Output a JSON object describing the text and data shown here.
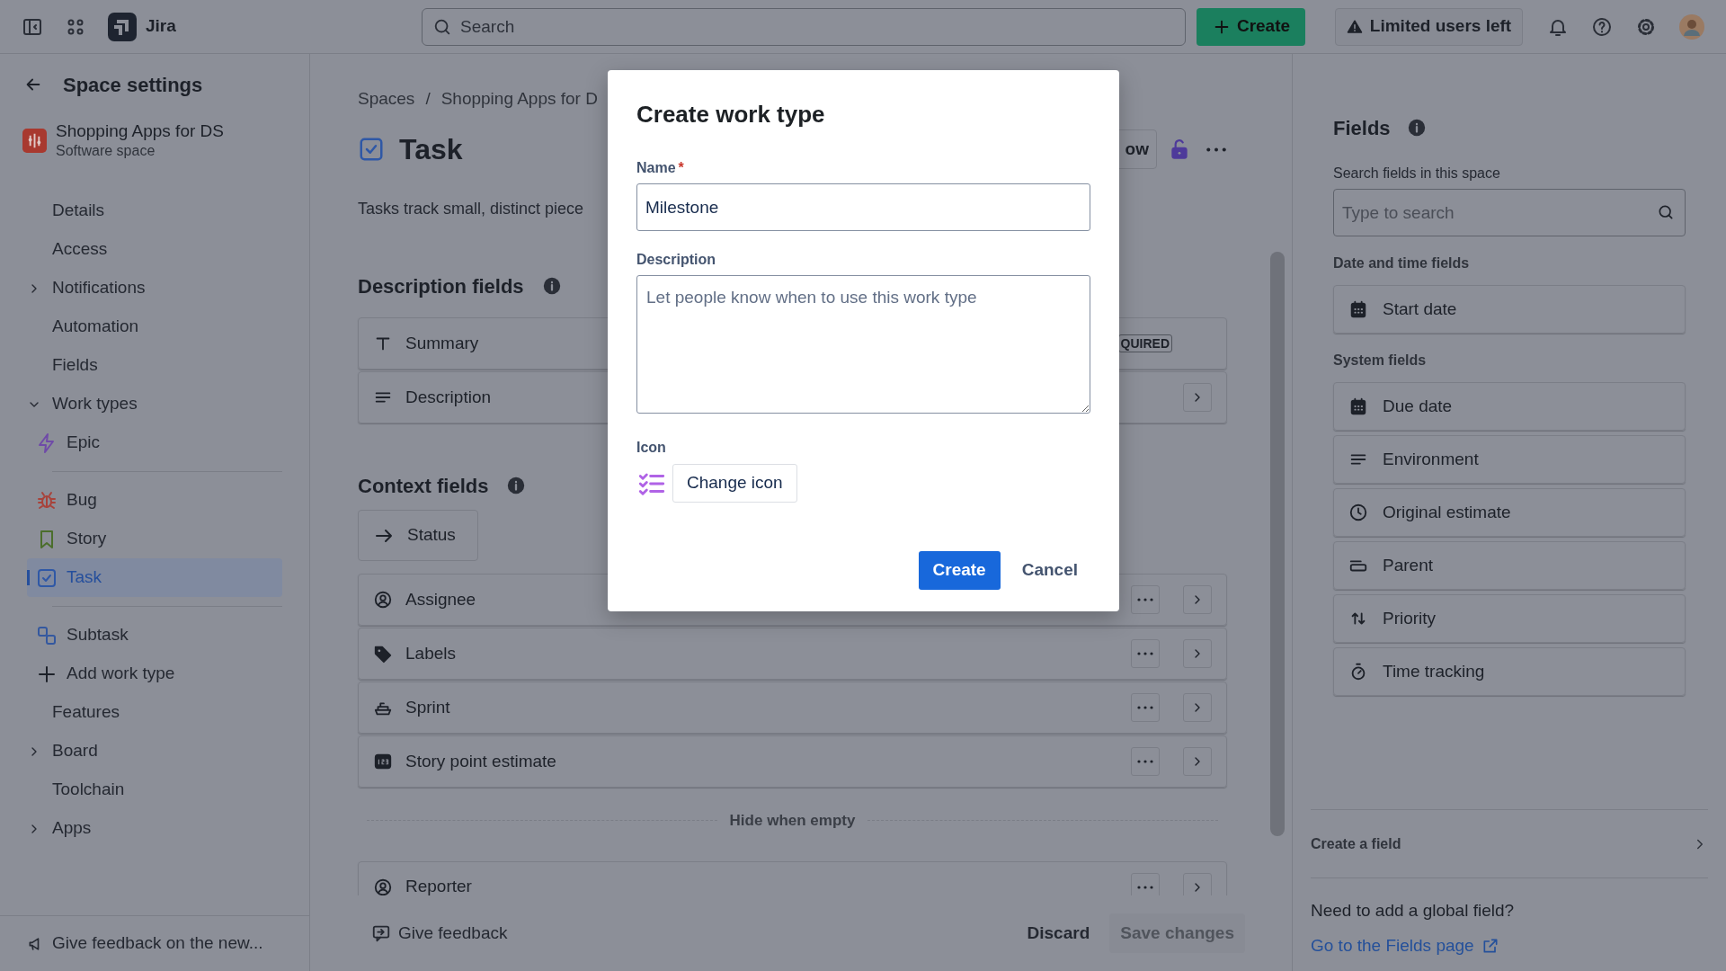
{
  "top_bar": {
    "app_name": "Jira",
    "search": {
      "placeholder": "Search"
    },
    "create_button": "Create",
    "notice_button": "Limited users left"
  },
  "sidebar": {
    "title": "Space settings",
    "space": {
      "name": "Shopping Apps for DS",
      "type": "Software space"
    },
    "items": [
      {
        "label": "Details",
        "selected": false
      },
      {
        "label": "Access",
        "selected": false
      },
      {
        "label": "Notifications",
        "selected": false,
        "expanded": false
      },
      {
        "label": "Automation",
        "selected": false
      },
      {
        "label": "Fields",
        "selected": false
      },
      {
        "label": "Work types",
        "selected": false,
        "expanded": true,
        "children": [
          {
            "label": "Epic",
            "kind": "epic",
            "selected": false,
            "divider_after": true
          },
          {
            "label": "Bug",
            "kind": "bug",
            "selected": false,
            "divider_after": false
          },
          {
            "label": "Story",
            "kind": "story",
            "selected": false,
            "divider_after": false
          },
          {
            "label": "Task",
            "kind": "task",
            "selected": true,
            "divider_after": true
          },
          {
            "label": "Subtask",
            "kind": "subtask",
            "selected": false,
            "divider_after": false
          },
          {
            "label": "Add work type",
            "kind": "add",
            "selected": false,
            "divider_after": false
          }
        ]
      },
      {
        "label": "Features",
        "selected": false
      },
      {
        "label": "Board",
        "selected": false,
        "expanded": false
      },
      {
        "label": "Toolchain",
        "selected": false
      },
      {
        "label": "Apps",
        "selected": false,
        "expanded": false
      }
    ],
    "feedback": "Give feedback on the new..."
  },
  "main": {
    "breadcrumbs": [
      "Spaces",
      "Shopping Apps for D"
    ],
    "breadcrumb_separator": "/",
    "title": "Task",
    "header_button": "ow",
    "description": "Tasks track small, distinct piece",
    "sections": [
      {
        "title": "Description fields",
        "fields": [
          {
            "label": "Summary",
            "kind": "text",
            "compact": false,
            "badge": "QUIRED",
            "menu": false,
            "open": false
          },
          {
            "label": "Description",
            "kind": "paragraph",
            "compact": false,
            "menu": false,
            "open": true
          }
        ]
      },
      {
        "title": "Context fields",
        "fields": [
          {
            "label": "Status",
            "kind": "arrow",
            "compact": true,
            "menu": false,
            "open": false
          },
          {
            "label": "Assignee",
            "kind": "person",
            "compact": false,
            "menu": true,
            "open": true
          },
          {
            "label": "Labels",
            "kind": "tag",
            "compact": false,
            "menu": true,
            "open": true
          },
          {
            "label": "Sprint",
            "kind": "boat",
            "compact": false,
            "menu": true,
            "open": true
          },
          {
            "label": "Story point estimate",
            "kind": "number",
            "compact": false,
            "menu": true,
            "open": true
          }
        ]
      }
    ],
    "hide_divider": "Hide when empty",
    "hidden_fields": [
      {
        "label": "Reporter",
        "kind": "person",
        "compact": false,
        "menu": true,
        "open": true
      }
    ],
    "footer": {
      "feedback": "Give feedback",
      "discard": "Discard",
      "save": {
        "label": "Save changes",
        "disabled": true
      }
    }
  },
  "right_panel": {
    "title": "Fields",
    "search": {
      "label": "Search fields in this space",
      "placeholder": "Type to search"
    },
    "groups": [
      {
        "title": "Date and time fields",
        "fields": [
          {
            "label": "Start date",
            "kind": "calendar"
          }
        ]
      },
      {
        "title": "System fields",
        "fields": [
          {
            "label": "Due date",
            "kind": "calendar"
          },
          {
            "label": "Environment",
            "kind": "paragraph"
          },
          {
            "label": "Original estimate",
            "kind": "clock"
          },
          {
            "label": "Parent",
            "kind": "parent"
          },
          {
            "label": "Priority",
            "kind": "priority"
          },
          {
            "label": "Time tracking",
            "kind": "timer"
          }
        ]
      }
    ],
    "create_field": "Create a field",
    "global_prompt": "Need to add a global field?",
    "fields_link": "Go to the Fields page"
  },
  "modal": {
    "title": "Create work type",
    "name": {
      "label": "Name",
      "required_mark": "*",
      "value": "Milestone"
    },
    "description": {
      "label": "Description",
      "placeholder": "Let people know when to use this work type"
    },
    "icon": {
      "label": "Icon",
      "button": "Change icon"
    },
    "buttons": {
      "primary": "Create",
      "secondary": "Cancel"
    }
  }
}
